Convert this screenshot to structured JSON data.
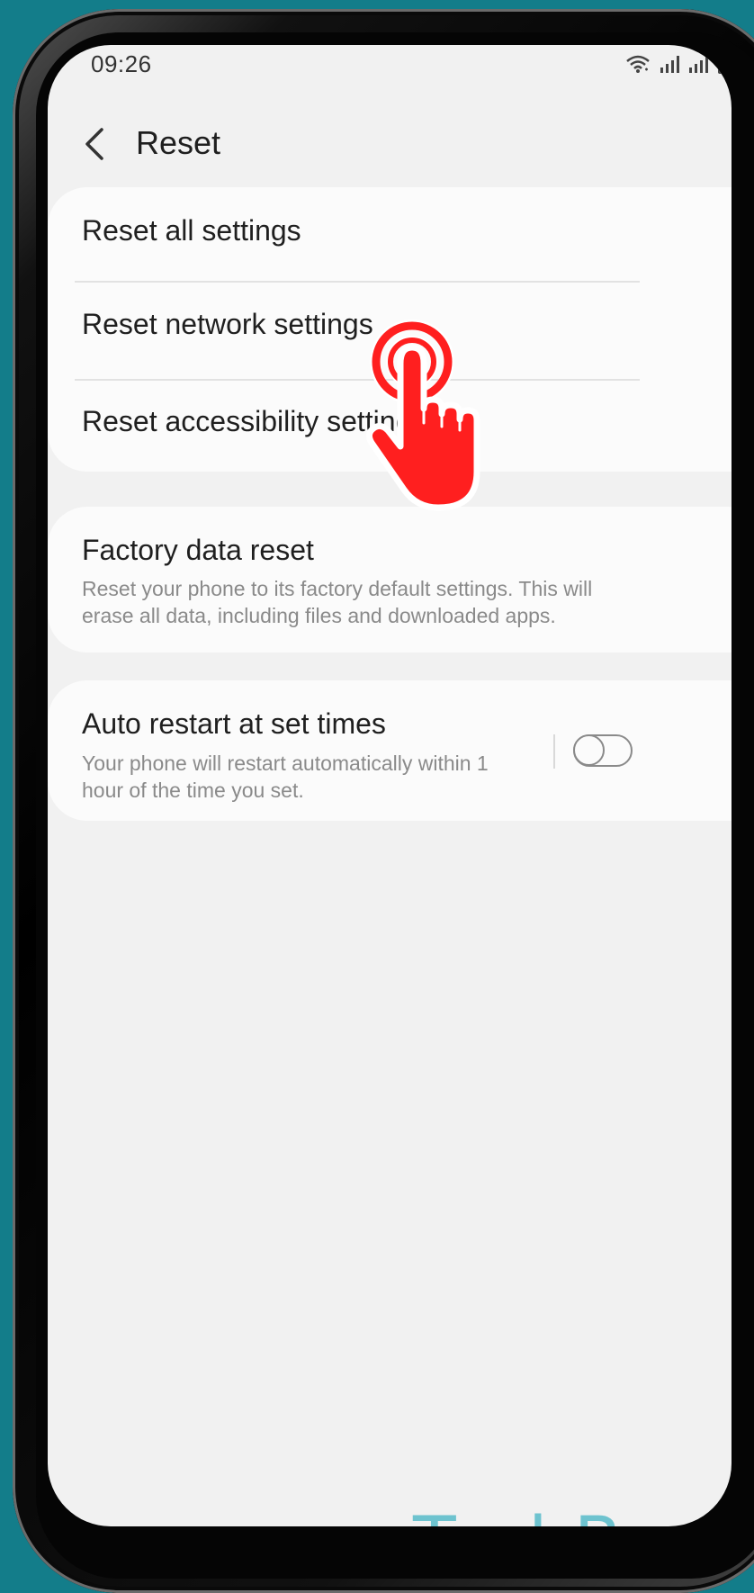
{
  "status_bar": {
    "time": "09:26",
    "icons": [
      "wifi-icon",
      "signal-icon",
      "signal-icon",
      "battery-icon"
    ]
  },
  "header": {
    "back_icon": "chevron-left-icon",
    "title": "Reset"
  },
  "reset_options": [
    {
      "label": "Reset all settings"
    },
    {
      "label": "Reset network settings"
    },
    {
      "label": "Reset accessibility settings"
    }
  ],
  "factory_reset": {
    "title": "Factory data reset",
    "subtitle_line1": "Reset your phone to its factory default settings. This will",
    "subtitle_line2": "erase all data, including files and downloaded apps."
  },
  "auto_restart": {
    "title": "Auto restart at set times",
    "subtitle_line1": "Your phone will restart automatically within 1",
    "subtitle_line2": "hour of the time you set.",
    "enabled": false
  },
  "overlay": {
    "icon": "tap-hand-icon",
    "color": "#ff1f1f"
  },
  "watermark": "TechBone",
  "colors": {
    "background": "#137d8a",
    "screen": "#f1f1f1",
    "card": "#fbfbfb",
    "watermark": "#6ec3cf"
  }
}
